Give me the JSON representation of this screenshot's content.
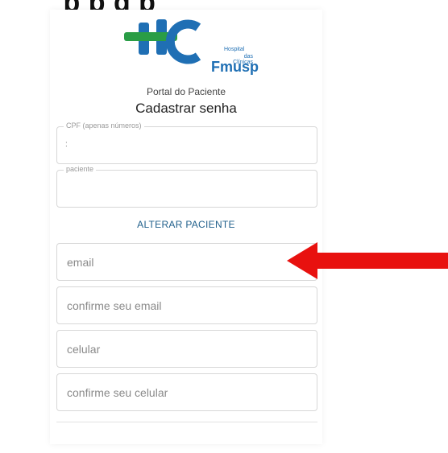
{
  "caption": {
    "partial_text": "'   p   p  g      p"
  },
  "logo": {
    "line1": "Hospital",
    "line2": "das Clínicas",
    "brand": "Fmusp",
    "colors": {
      "blue": "#1f6fb4",
      "green": "#2a9d46"
    }
  },
  "portal_label": "Portal do Paciente",
  "page_title": "Cadastrar senha",
  "fields": {
    "cpf": {
      "legend": "CPF (apenas números)",
      "value": ":"
    },
    "paciente": {
      "legend": "paciente",
      "value": ""
    }
  },
  "change_patient_label": "ALTERAR PACIENTE",
  "inputs": {
    "email": {
      "placeholder": "email",
      "value": ""
    },
    "confirm_email": {
      "placeholder": "confirme seu email",
      "value": ""
    },
    "celular": {
      "placeholder": "celular",
      "value": ""
    },
    "confirm_celular": {
      "placeholder": "confirme seu celular",
      "value": ""
    }
  },
  "bottom_cut_text": "",
  "annotation": {
    "color": "#e8110f",
    "points_to": "email"
  }
}
